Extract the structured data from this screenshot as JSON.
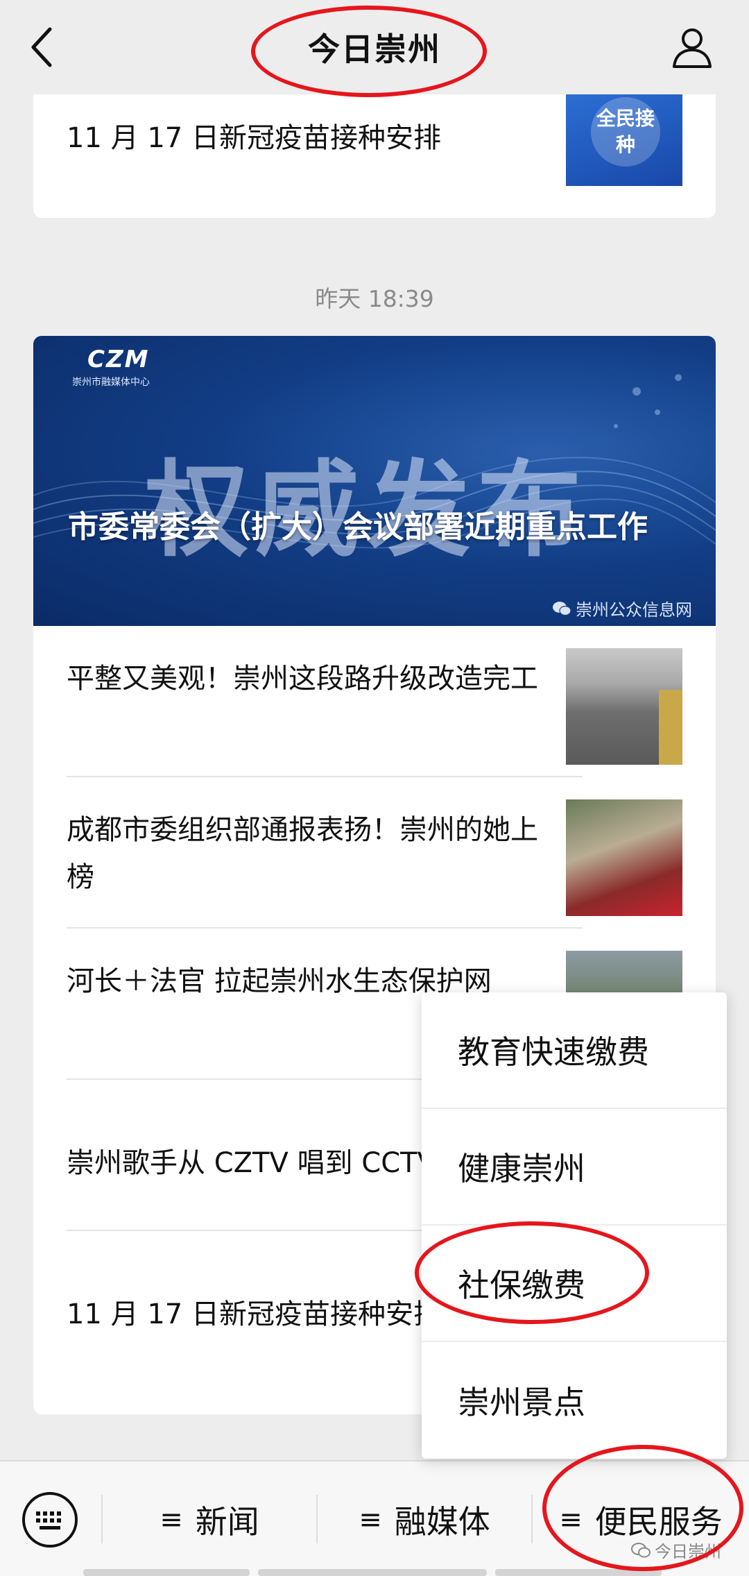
{
  "header": {
    "title": "今日崇州"
  },
  "top_card": {
    "title": "11 月 17 日新冠疫苗接种安排",
    "thumb_text": "全民接种"
  },
  "timestamp": "昨天 18:39",
  "banner": {
    "logo": "CZM",
    "logo_sub": "崇州市融媒体中心",
    "big_text": "权威发布",
    "headline": "市委常委会（扩大）会议部署近期重点工作",
    "source": "崇州公众信息网"
  },
  "articles": [
    {
      "title": "平整又美观！崇州这段路升级改造完工"
    },
    {
      "title": "成都市委组织部通报表扬！崇州的她上榜"
    },
    {
      "title": "河长＋法官 拉起崇州水生态保护网"
    },
    {
      "title": "崇州歌手从 CZTV 唱到 CCTV"
    },
    {
      "title": "11 月 17 日新冠疫苗接种安排"
    }
  ],
  "popup_menu": [
    "教育快速缴费",
    "健康崇州",
    "社保缴费",
    "崇州景点"
  ],
  "bottom_menu": {
    "news": "新闻",
    "media": "融媒体",
    "service": "便民服务"
  },
  "watermark": "今日崇州"
}
